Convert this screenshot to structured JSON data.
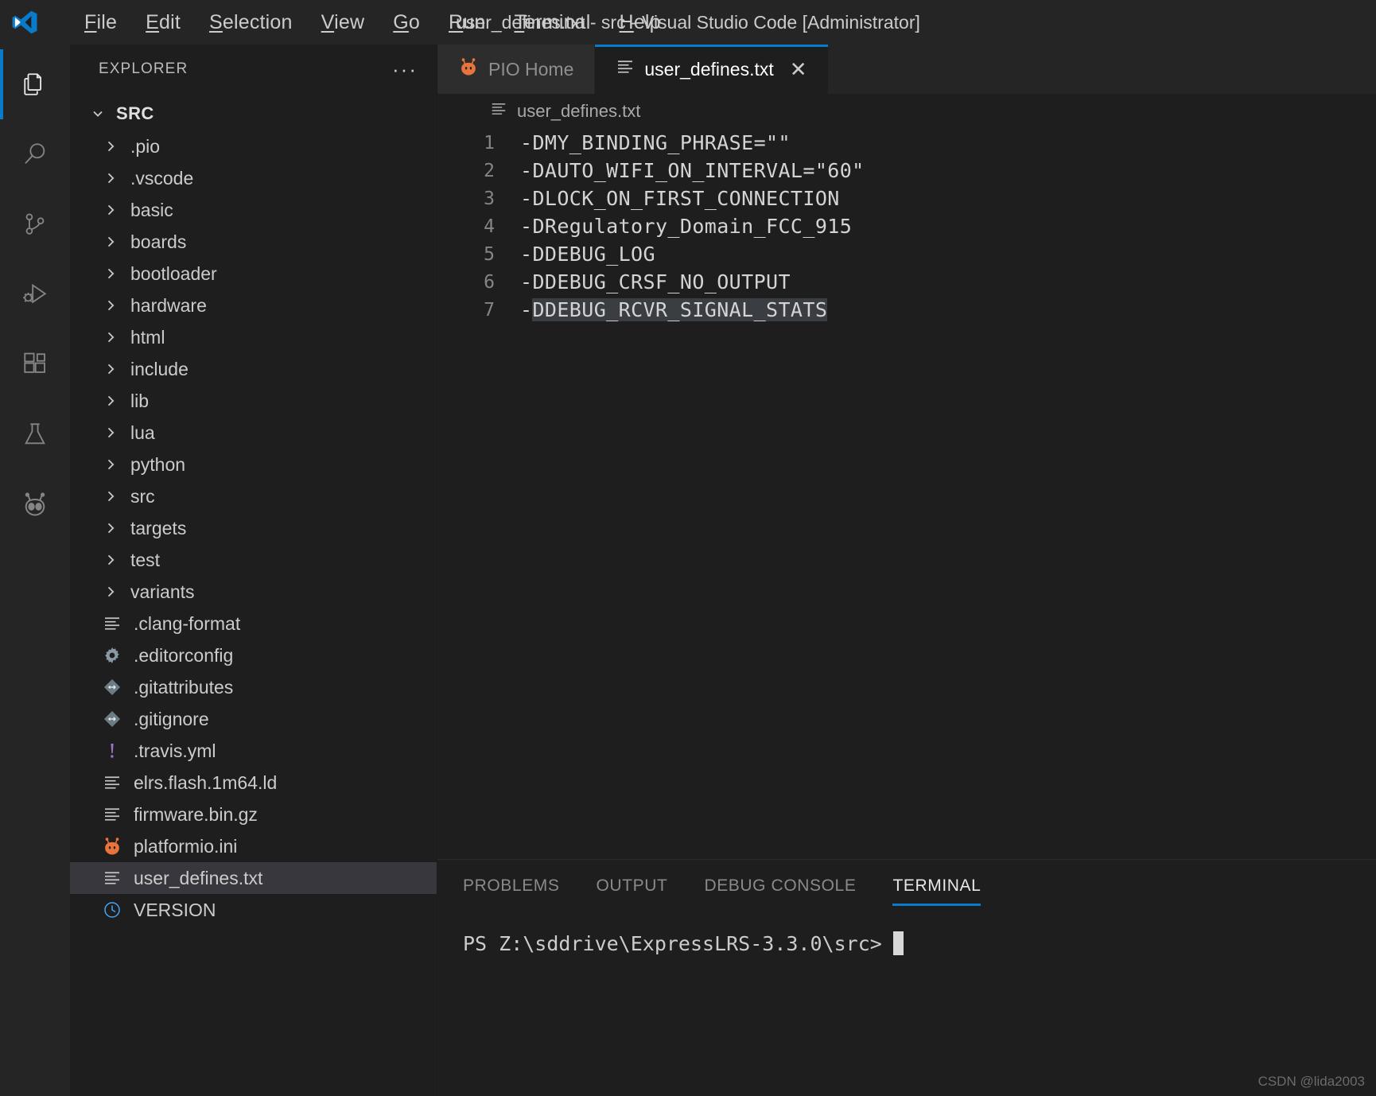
{
  "titlebar": {
    "logo_icon": "vscode-logo-icon",
    "window_title": "user_defines.txt - src - Visual Studio Code [Administrator]",
    "menus": [
      {
        "label": "File",
        "mnemonic": "F"
      },
      {
        "label": "Edit",
        "mnemonic": "E"
      },
      {
        "label": "Selection",
        "mnemonic": "S"
      },
      {
        "label": "View",
        "mnemonic": "V"
      },
      {
        "label": "Go",
        "mnemonic": "G"
      },
      {
        "label": "Run",
        "mnemonic": "R"
      },
      {
        "label": "Terminal",
        "mnemonic": "T"
      },
      {
        "label": "Help",
        "mnemonic": "H"
      }
    ]
  },
  "activity_bar": {
    "items": [
      {
        "icon": "files-explorer-icon",
        "name": "explorer",
        "active": true
      },
      {
        "icon": "search-icon",
        "name": "search",
        "active": false
      },
      {
        "icon": "source-control-icon",
        "name": "source-control",
        "active": false
      },
      {
        "icon": "run-and-debug-icon",
        "name": "run-debug",
        "active": false
      },
      {
        "icon": "extensions-icon",
        "name": "extensions",
        "active": false
      },
      {
        "icon": "testing-flask-icon",
        "name": "testing",
        "active": false
      },
      {
        "icon": "platformio-alien-icon",
        "name": "platformio",
        "active": false
      }
    ]
  },
  "sidebar": {
    "title": "EXPLORER",
    "more_actions_label": "···",
    "root": {
      "label": "SRC",
      "expanded": true,
      "chevron": "chevron-down-icon"
    },
    "items": [
      {
        "label": ".pio",
        "type": "folder",
        "icon": "chevron-right-icon",
        "selected": false
      },
      {
        "label": ".vscode",
        "type": "folder",
        "icon": "chevron-right-icon",
        "selected": false
      },
      {
        "label": "basic",
        "type": "folder",
        "icon": "chevron-right-icon",
        "selected": false
      },
      {
        "label": "boards",
        "type": "folder",
        "icon": "chevron-right-icon",
        "selected": false
      },
      {
        "label": "bootloader",
        "type": "folder",
        "icon": "chevron-right-icon",
        "selected": false
      },
      {
        "label": "hardware",
        "type": "folder",
        "icon": "chevron-right-icon",
        "selected": false
      },
      {
        "label": "html",
        "type": "folder",
        "icon": "chevron-right-icon",
        "selected": false
      },
      {
        "label": "include",
        "type": "folder",
        "icon": "chevron-right-icon",
        "selected": false
      },
      {
        "label": "lib",
        "type": "folder",
        "icon": "chevron-right-icon",
        "selected": false
      },
      {
        "label": "lua",
        "type": "folder",
        "icon": "chevron-right-icon",
        "selected": false
      },
      {
        "label": "python",
        "type": "folder",
        "icon": "chevron-right-icon",
        "selected": false
      },
      {
        "label": "src",
        "type": "folder",
        "icon": "chevron-right-icon",
        "selected": false
      },
      {
        "label": "targets",
        "type": "folder",
        "icon": "chevron-right-icon",
        "selected": false
      },
      {
        "label": "test",
        "type": "folder",
        "icon": "chevron-right-icon",
        "selected": false
      },
      {
        "label": "variants",
        "type": "folder",
        "icon": "chevron-right-icon",
        "selected": false
      },
      {
        "label": ".clang-format",
        "type": "file",
        "icon": "text-file-icon",
        "selected": false
      },
      {
        "label": ".editorconfig",
        "type": "file",
        "icon": "gear-icon",
        "selected": false
      },
      {
        "label": ".gitattributes",
        "type": "file",
        "icon": "git-icon",
        "selected": false
      },
      {
        "label": ".gitignore",
        "type": "file",
        "icon": "git-icon",
        "selected": false
      },
      {
        "label": ".travis.yml",
        "type": "file",
        "icon": "exclamation-icon",
        "selected": false
      },
      {
        "label": "elrs.flash.1m64.ld",
        "type": "file",
        "icon": "text-file-icon",
        "selected": false
      },
      {
        "label": "firmware.bin.gz",
        "type": "file",
        "icon": "text-file-icon",
        "selected": false
      },
      {
        "label": "platformio.ini",
        "type": "file",
        "icon": "platformio-alien-icon",
        "selected": false
      },
      {
        "label": "user_defines.txt",
        "type": "file",
        "icon": "text-file-icon",
        "selected": true
      },
      {
        "label": "VERSION",
        "type": "file",
        "icon": "clock-icon",
        "selected": false
      }
    ]
  },
  "editor": {
    "tabs": [
      {
        "label": "PIO Home",
        "icon": "platformio-alien-icon",
        "active": false,
        "closable": false
      },
      {
        "label": "user_defines.txt",
        "icon": "text-file-icon",
        "active": true,
        "closable": true,
        "close_label": "✕"
      }
    ],
    "breadcrumb": {
      "icon": "text-file-icon",
      "label": "user_defines.txt"
    },
    "lines": [
      {
        "number": "1",
        "text": "-DMY_BINDING_PHRASE=\"\"",
        "selected": false
      },
      {
        "number": "2",
        "text": "-DAUTO_WIFI_ON_INTERVAL=\"60\"",
        "selected": false
      },
      {
        "number": "3",
        "text": "-DLOCK_ON_FIRST_CONNECTION",
        "selected": false
      },
      {
        "number": "4",
        "text": "-DRegulatory_Domain_FCC_915",
        "selected": false
      },
      {
        "number": "5",
        "text": "-DDEBUG_LOG",
        "selected": false
      },
      {
        "number": "6",
        "text": "-DDEBUG_CRSF_NO_OUTPUT",
        "selected": false
      },
      {
        "number": "7",
        "text": "-DDEBUG_RCVR_SIGNAL_STATS",
        "selected": true,
        "selection_start": 1
      }
    ]
  },
  "panel": {
    "tabs": [
      {
        "label": "PROBLEMS",
        "active": false
      },
      {
        "label": "OUTPUT",
        "active": false
      },
      {
        "label": "DEBUG CONSOLE",
        "active": false
      },
      {
        "label": "TERMINAL",
        "active": true
      }
    ],
    "terminal_prompt": "PS Z:\\sddrive\\ExpressLRS-3.3.0\\src>"
  },
  "watermark": "CSDN @lida2003",
  "colors": {
    "accent_blue": "#0a7aca",
    "bg": "#1e1e1e",
    "chrome": "#252526",
    "tab_inactive": "#2d2d2d",
    "selection_gray": "#3a3d41",
    "tree_selected": "#37373d",
    "platformio_orange": "#e8743b",
    "travis_purple": "#a074c4",
    "version_blue": "#42a5f5"
  }
}
